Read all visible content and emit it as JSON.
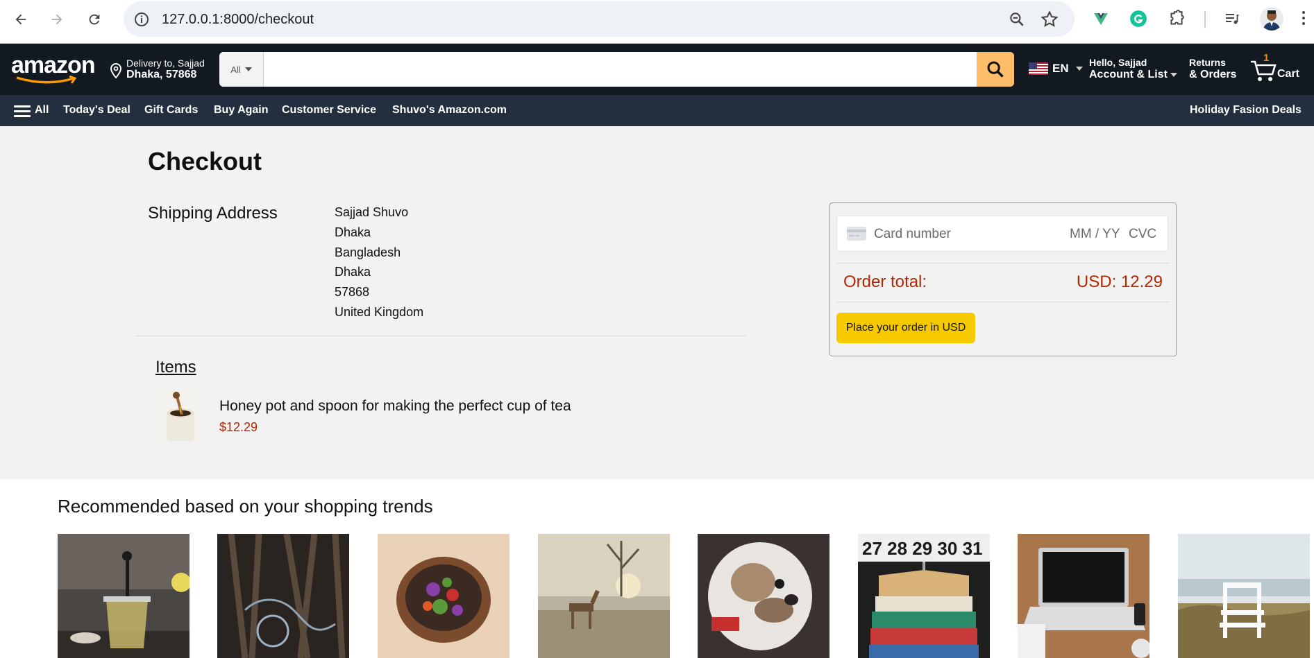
{
  "browser": {
    "url": "127.0.0.1:8000/checkout"
  },
  "header": {
    "logo": "amazon",
    "delivery_line1": "Delivery to, Sajjad",
    "delivery_line2": "Dhaka, 57868",
    "search_category": "All",
    "search_placeholder": "",
    "language": "EN",
    "account_line1": "Hello, Sajjad",
    "account_line2": "Account & List",
    "returns_line1": "Returns",
    "returns_line2": "& Orders",
    "cart_count": "1",
    "cart_label": "Cart"
  },
  "nav": {
    "all_label": "All",
    "items": [
      "Today's Deal",
      "Gift Cards",
      "Buy Again",
      "Customer Service",
      "Shuvo's Amazon.com"
    ],
    "right_item": "Holiday Fasion Deals"
  },
  "checkout": {
    "title": "Checkout",
    "shipping_label": "Shipping Address",
    "address": [
      "Sajjad Shuvo",
      "Dhaka",
      "Bangladesh",
      "Dhaka",
      "57868",
      "United Kingdom"
    ],
    "items_label": "Items",
    "item": {
      "title": "Honey pot and spoon for making the perfect cup of tea",
      "price": "$12.29"
    }
  },
  "payment": {
    "card_number_placeholder": "Card number",
    "expiry_placeholder": "MM / YY",
    "cvc_placeholder": "CVC",
    "order_total_label": "Order total:",
    "order_total_value": "USD: 12.29",
    "place_order_label": "Place your order in USD"
  },
  "recommendations": {
    "title": "Recommended based on your shopping trends",
    "items": [
      "teapot",
      "tools",
      "salad-bowl",
      "deer",
      "bulldog",
      "clothes-rack",
      "laptop",
      "beach-chair"
    ]
  },
  "colors": {
    "amazon_dark": "#131921",
    "amazon_nav": "#232f3e",
    "search_button": "#febd69",
    "price_red": "#b12704",
    "place_button": "#f7ca00"
  }
}
